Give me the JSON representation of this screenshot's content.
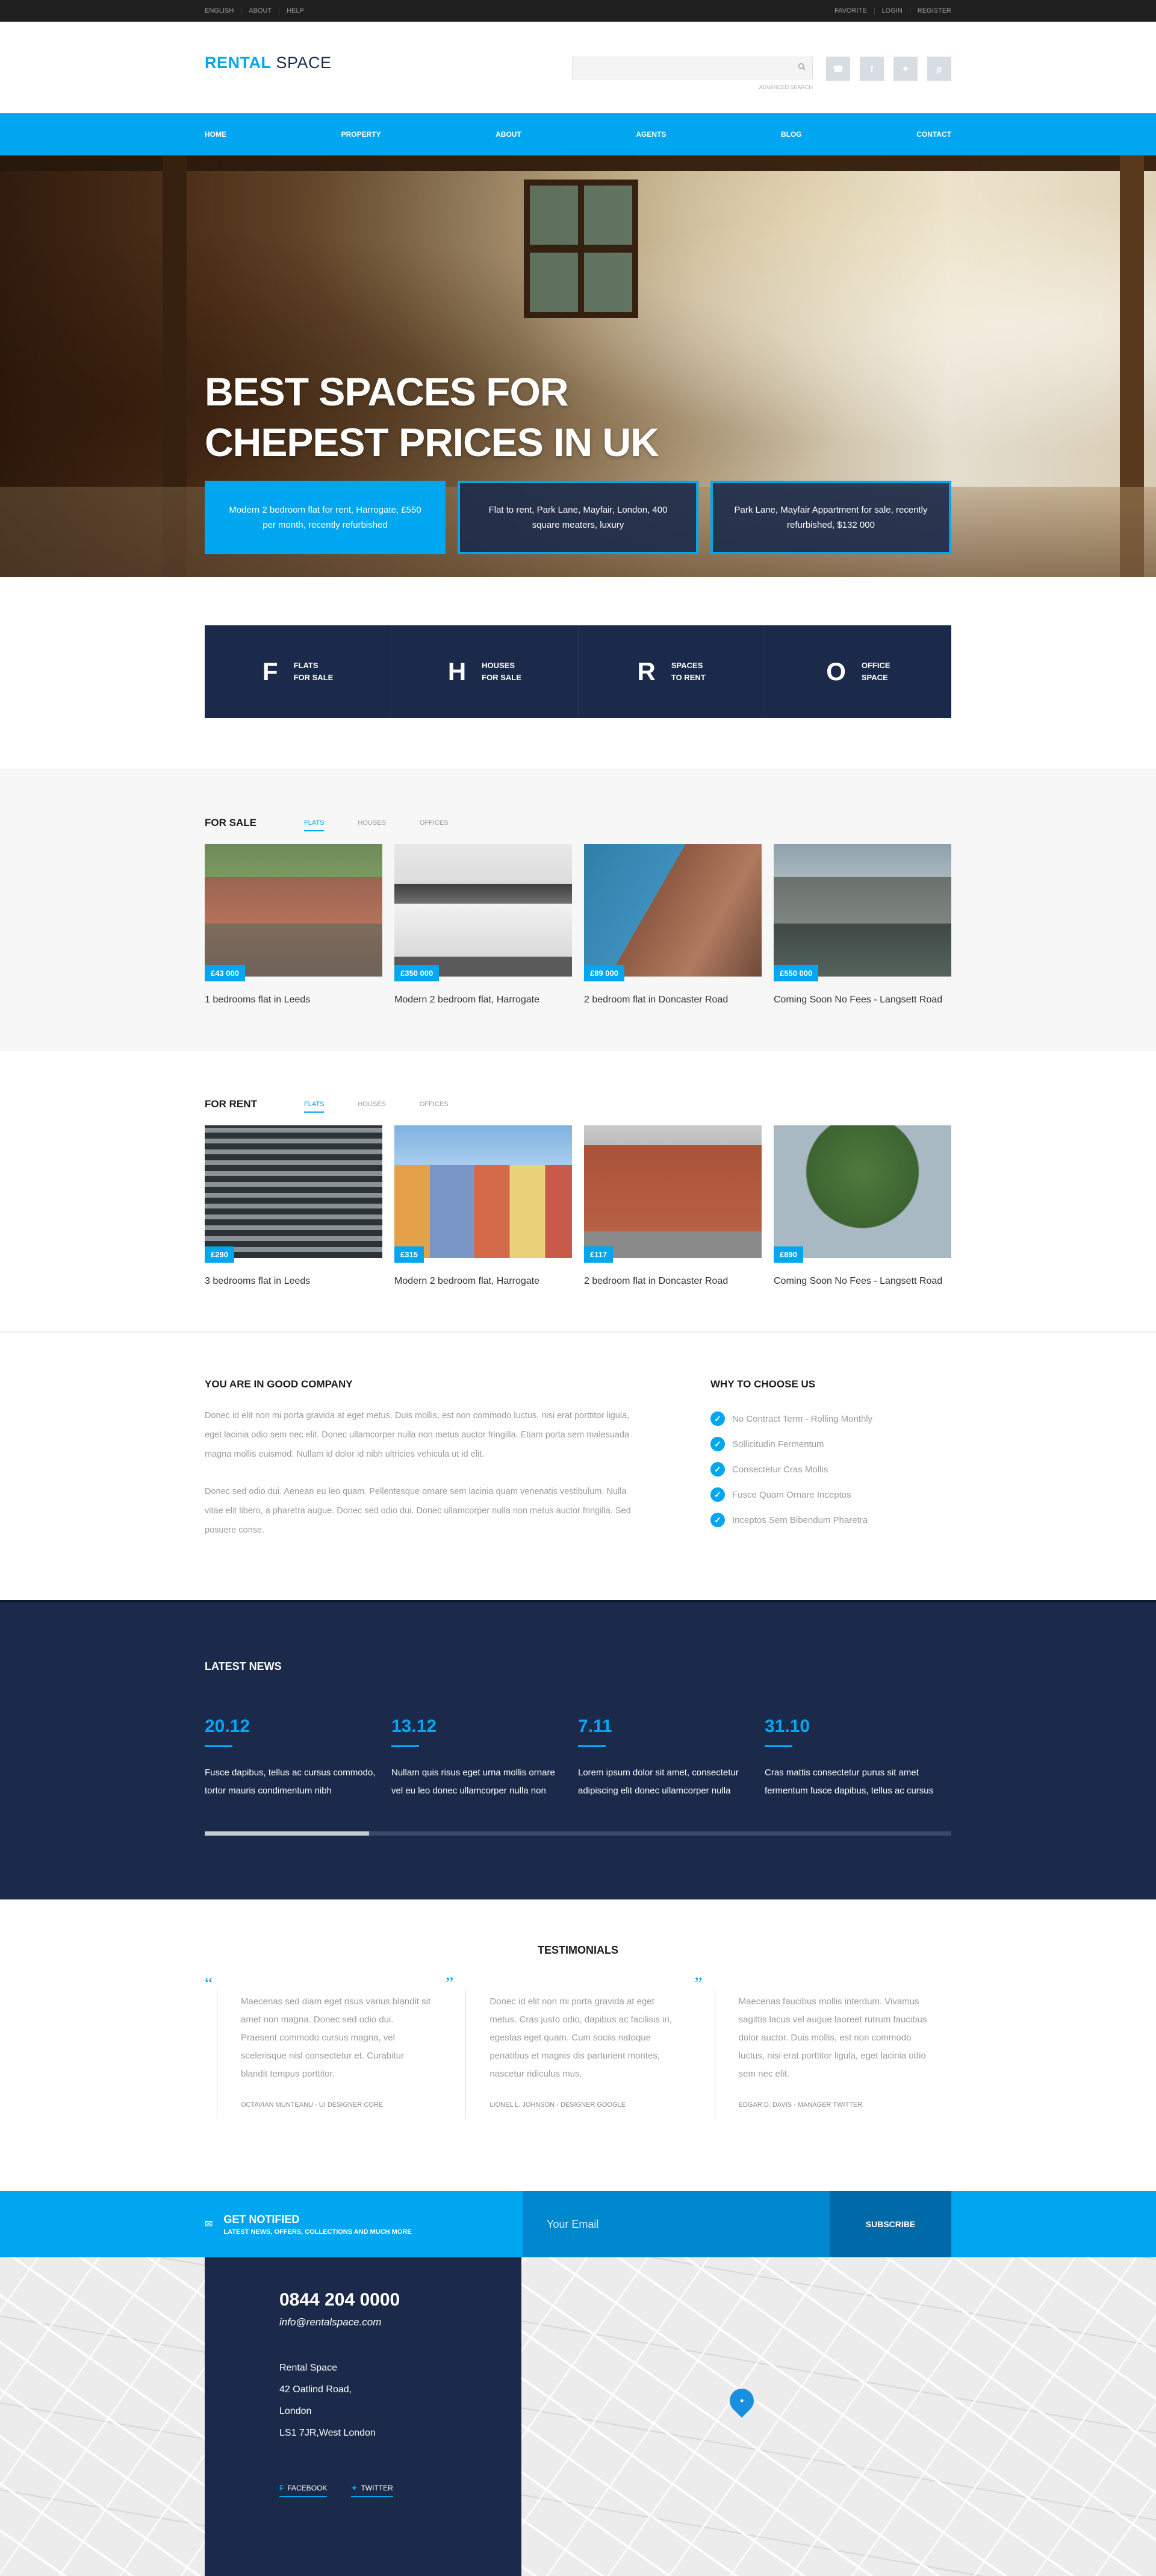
{
  "topbar": {
    "left": [
      "ENGLISH",
      "ABOUT",
      "HELP"
    ],
    "right": [
      "FAVORITE",
      "LOGIN",
      "REGISTER"
    ]
  },
  "header": {
    "logo_a": "RENTAL",
    "logo_b": " SPACE",
    "search_placeholder": "",
    "advanced_search": "ADVANCED SEARCH",
    "social_icons": [
      "phone-icon",
      "facebook-icon",
      "twitter-icon",
      "pinterest-icon"
    ]
  },
  "nav": [
    "HOME",
    "PROPERTY",
    "ABOUT",
    "AGENTS",
    "BLOG",
    "CONTACT"
  ],
  "hero": {
    "line1": "BEST SPACES FOR",
    "line2": "CHEPEST PRICES IN UK",
    "cards": [
      "Modern 2 bedroom flat for rent, Harrogate, £550 per month, recently refurbished",
      "Flat to rent, Park Lane, Mayfair, London, 400 square meaters, luxury",
      "Park Lane, Mayfair Appartment for sale, recently refurbished, $132 000"
    ]
  },
  "categories": [
    {
      "letter": "F",
      "l1": "FLATS",
      "l2": "FOR SALE"
    },
    {
      "letter": "H",
      "l1": "HOUSES",
      "l2": "FOR SALE"
    },
    {
      "letter": "R",
      "l1": "SPACES",
      "l2": "TO RENT"
    },
    {
      "letter": "O",
      "l1": "OFFICE",
      "l2": "SPACE"
    }
  ],
  "for_sale": {
    "title": "FOR SALE",
    "tabs": [
      "FLATS",
      "HOUSES",
      "OFFICES"
    ],
    "items": [
      {
        "price": "£43 000",
        "caption": "1 bedrooms flat in Leeds"
      },
      {
        "price": "£350 000",
        "caption": "Modern 2 bedroom flat, Harrogate"
      },
      {
        "price": "£89 000",
        "caption": "2 bedroom flat in Doncaster Road"
      },
      {
        "price": "£550 000",
        "caption": "Coming Soon No Fees - Langsett Road"
      }
    ]
  },
  "for_rent": {
    "title": "FOR RENT",
    "tabs": [
      "FLATS",
      "HOUSES",
      "OFFICES"
    ],
    "items": [
      {
        "price": "£290",
        "caption": "3 bedrooms flat in Leeds"
      },
      {
        "price": "£315",
        "caption": "Modern 2 bedroom flat, Harrogate"
      },
      {
        "price": "£117",
        "caption": "2 bedroom flat in Doncaster Road"
      },
      {
        "price": "£890",
        "caption": "Coming Soon No Fees - Langsett Road"
      }
    ]
  },
  "company": {
    "title": "YOU ARE IN GOOD COMPANY",
    "p1": "Donec id elit non mi porta gravida at eget metus. Duis mollis, est non commodo luctus, nisi erat porttitor ligula, eget lacinia odio sem nec elit. Donec ullamcorper nulla non metus auctor fringilla. Etiam porta sem malesuada magna mollis euismod. Nullam id dolor id nibh ultricies vehicula ut id elit.",
    "p2": "Donec sed odio dui. Aenean eu leo quam. Pellentesque ornare sem lacinia quam venenatis vestibulum. Nulla vitae elit libero, a pharetra augue. Donec sed odio dui. Donec ullamcorper nulla non metus auctor fringilla. Sed posuere conse."
  },
  "why": {
    "title": "WHY TO CHOOSE US",
    "items": [
      "No Contract Term - Rolling Monthly",
      "Sollicitudin Fermentum",
      "Consectetur Cras Mollis",
      "Fusce Quam Ornare Inceptos",
      "Inceptos Sem Bibendum Pharetra"
    ]
  },
  "news": {
    "title": "LATEST NEWS",
    "items": [
      {
        "date": "20.12",
        "text": "Fusce dapibus, tellus ac cursus commodo, tortor mauris condimentum nibh"
      },
      {
        "date": "13.12",
        "text": "Nullam quis risus eget urna mollis ornare vel eu leo donec ullamcorper nulla non"
      },
      {
        "date": "7.11",
        "text": "Lorem ipsum dolor sit amet, consectetur adipiscing elit donec ullamcorper nulla"
      },
      {
        "date": "31.10",
        "text": "Cras mattis consectetur purus sit amet fermentum fusce dapibus, tellus ac cursus"
      }
    ],
    "scroll_fraction": 0.22
  },
  "testimonials": {
    "title": "TESTIMONIALS",
    "items": [
      {
        "text": "Maecenas sed diam eget risus varius blandit sit amet non magna. Donec sed odio dui. Praesent commodo cursus magna, vel scelerisque nisl consectetur et. Curabitur blandit tempus porttitor.",
        "who": "OCTAVIAN MUNTEANU - UI DESIGNER CORE"
      },
      {
        "text": "Donec id elit non mi porta gravida at eget metus. Cras justo odio, dapibus ac facilisis in, egestas eget quam. Cum sociis natoque penatibus et magnis dis parturient montes, nascetur ridiculus mus.",
        "who": "LIONEL L. JOHNSON - DESIGNER GOOGLE"
      },
      {
        "text": "Maecenas faucibus mollis interdum. Vivamus sagittis lacus vel augue laoreet rutrum faucibus dolor auctor. Duis mollis, est non commodo luctus, nisi erat porttitor ligula, eget lacinia odio sem nec elit.",
        "who": "EDGAR D. DAVIS - MANAGER TWITTER"
      }
    ]
  },
  "notify": {
    "title": "GET NOTIFIED",
    "subtitle": "LATEST NEWS, OFFERS, COLLECTIONS AND MUCH MORE",
    "placeholder": "Your Email",
    "button": "SUBSCRIBE"
  },
  "footer": {
    "phone": "0844 204 0000",
    "email": "info@rentalspace.com",
    "address": [
      "Rental Space",
      "42 Oatlind Road,",
      "London",
      "LS1 7JR,West London"
    ],
    "facebook": "FACEBOOK",
    "twitter": "TWITTER"
  },
  "colors": {
    "accent": "#00a6f0",
    "navy": "#1b2a4a",
    "topbar": "#1f1f1f"
  }
}
